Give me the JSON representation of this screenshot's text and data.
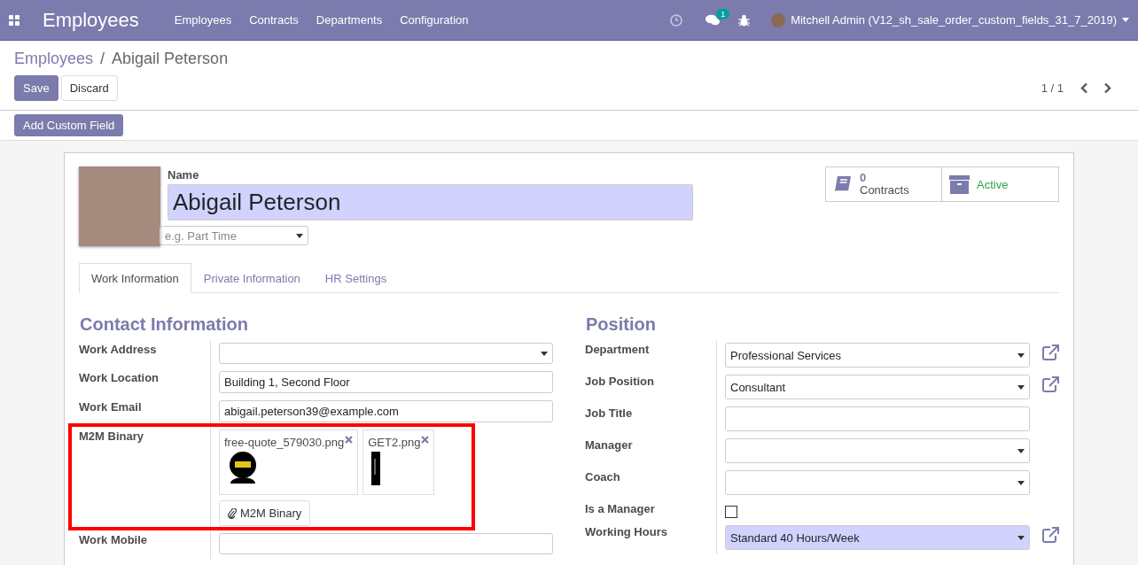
{
  "navbar": {
    "app_title": "Employees",
    "menu": [
      "Employees",
      "Contracts",
      "Departments",
      "Configuration"
    ],
    "message_count": "1",
    "user": "Mitchell Admin (V12_sh_sale_order_custom_fields_31_7_2019)"
  },
  "breadcrumbs": [
    {
      "label": "Employees",
      "link": true
    },
    {
      "label": "Abigail Peterson",
      "link": false
    }
  ],
  "breadcrumb_separator": "/",
  "buttons": [
    {
      "label": "Save",
      "kind": "primary"
    },
    {
      "label": "Discard",
      "kind": "secondary"
    }
  ],
  "pager": "1 / 1",
  "custom_button": "Add Custom Field",
  "employee": {
    "name_label": "Name",
    "name": "Abigail Peterson",
    "name_required": true,
    "tag_placeholder": "e.g. Part Time"
  },
  "smart_buttons": [
    {
      "kind": "count",
      "count": "0",
      "label": "Contracts"
    },
    {
      "kind": "toggle",
      "label": "Active",
      "active": true
    }
  ],
  "tabs": [
    {
      "label": "Work Information",
      "selected": true
    },
    {
      "label": "Private Information",
      "selected": false
    },
    {
      "label": "HR Settings",
      "selected": false
    }
  ],
  "sections": [
    {
      "title": "Contact Information",
      "fields": [
        {
          "label": "Work Address",
          "kind": "select",
          "required": false
        },
        {
          "label": "Work Location",
          "kind": "text",
          "value": "Building 1, Second Floor",
          "required": false
        },
        {
          "label": "Work Email",
          "kind": "text",
          "value": "abigail.peterson39@example.com",
          "required": false
        },
        {
          "label": "M2M Binary",
          "kind": "binary",
          "highlighted": true,
          "files": [
            {
              "name": "free-quote_579030.png",
              "kind": "badge"
            },
            {
              "name": "GET2.png",
              "kind": "bar"
            }
          ],
          "button": "M2M Binary"
        },
        {
          "label": "Work Mobile",
          "kind": "text",
          "required": false
        }
      ]
    },
    {
      "title": "Position",
      "fields": [
        {
          "label": "Department",
          "kind": "select",
          "value": "Professional Services",
          "required": false,
          "external": true
        },
        {
          "label": "Job Position",
          "kind": "select",
          "value": "Consultant",
          "required": false,
          "external": true
        },
        {
          "label": "Job Title",
          "kind": "text",
          "required": false
        },
        {
          "label": "Manager",
          "kind": "select",
          "required": false,
          "external": false
        },
        {
          "label": "Coach",
          "kind": "select",
          "required": false,
          "external": false
        },
        {
          "label": "Is a Manager",
          "kind": "checkbox",
          "checked": false
        },
        {
          "label": "Working Hours",
          "kind": "select",
          "value": "Standard 40 Hours/Week",
          "required": true,
          "external": true
        }
      ]
    }
  ]
}
